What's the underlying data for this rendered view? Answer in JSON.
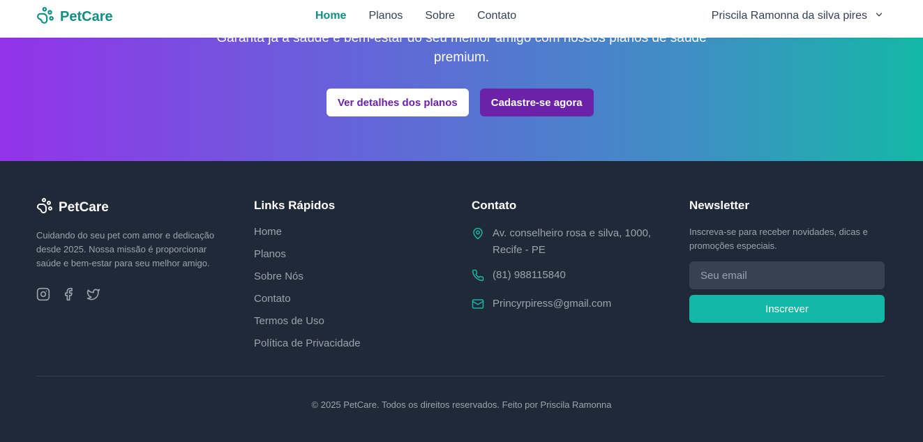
{
  "brand": {
    "name": "PetCare",
    "color": "#0f8f82"
  },
  "header": {
    "nav": [
      {
        "label": "Home",
        "active": true
      },
      {
        "label": "Planos",
        "active": false
      },
      {
        "label": "Sobre",
        "active": false
      },
      {
        "label": "Contato",
        "active": false
      }
    ],
    "user_name": "Priscila Ramonna da silva pires"
  },
  "hero": {
    "subtitle_line1": "Garanta já a saúde e bem-estar do seu melhor amigo com nossos planos de saúde",
    "subtitle_line2": "premium.",
    "btn_details": "Ver detalhes dos planos",
    "btn_signup": "Cadastre-se agora",
    "gradient": [
      "#9333ea",
      "#14b8a6"
    ]
  },
  "footer": {
    "brand": "PetCare",
    "about": "Cuidando do seu pet com amor e dedicação desde 2025. Nossa missão é proporcionar saúde e bem-estar para seu melhor amigo.",
    "socials": [
      "instagram-icon",
      "facebook-icon",
      "twitter-icon"
    ],
    "links_title": "Links Rápidos",
    "links": [
      "Home",
      "Planos",
      "Sobre Nós",
      "Contato",
      "Termos de Uso",
      "Política de Privacidade"
    ],
    "contact_title": "Contato",
    "contact": {
      "address": "Av. conselheiro rosa e silva, 1000, Recife - PE",
      "phone": "(81) 988115840",
      "email": "Princyrpiress@gmail.com"
    },
    "newsletter_title": "Newsletter",
    "newsletter_text": "Inscreva-se para receber novidades, dicas e promoções especiais.",
    "email_placeholder": "Seu email",
    "subscribe_label": "Inscrever",
    "copyright": "© 2025 PetCare. Todos os direitos reservados. Feito por Priscila Ramonna"
  },
  "colors": {
    "accent": "#14b8a6",
    "footer_bg": "#1f2937",
    "purple": "#6b21a8"
  }
}
